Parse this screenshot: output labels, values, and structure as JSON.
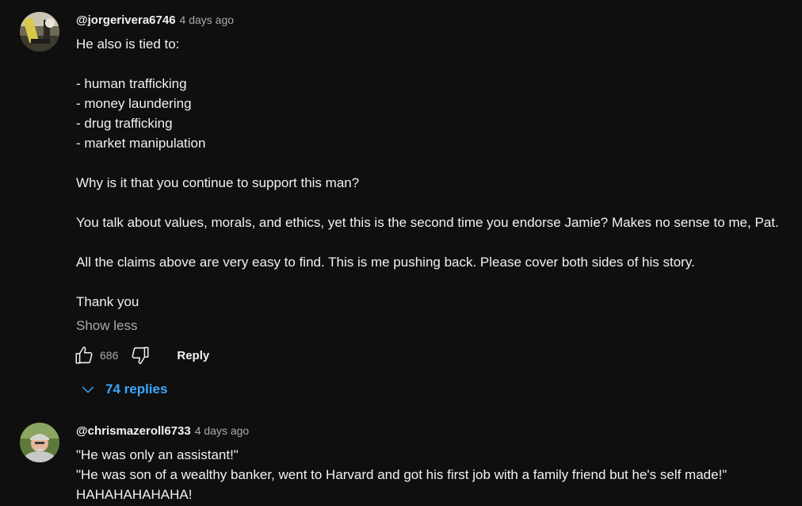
{
  "comments": [
    {
      "author": "@jorgerivera6746",
      "timestamp": "4 days ago",
      "avatar_icon": "avatar-photo-icon",
      "lines": [
        "He also is tied to:",
        "",
        "- human trafficking",
        "- money laundering",
        "- drug trafficking",
        "- market manipulation",
        "",
        "Why is it that you continue to support this man?",
        "",
        "You talk about values, morals, and ethics, yet this is the second time you endorse Jamie? Makes no sense to me, Pat.",
        "",
        "All the claims above are very easy to find. This is me pushing back. Please cover both sides of his story.",
        "",
        "Thank you"
      ],
      "show_less_label": "Show less",
      "like_count": "686",
      "reply_label": "Reply",
      "replies_label": "74 replies"
    },
    {
      "author": "@chrismazeroll6733",
      "timestamp": "4 days ago",
      "avatar_icon": "avatar-photo-icon",
      "lines": [
        "\"He was only an assistant!\"",
        "\"He was son of a wealthy banker, went to Harvard and got his first job with a family friend but he's self made!\"",
        "HAHAHAHAHAHA!"
      ]
    }
  ],
  "colors": {
    "background": "#0f0f0f",
    "text": "#f1f1f1",
    "secondary_text": "#aaaaaa",
    "link_blue": "#3ea6ff"
  }
}
